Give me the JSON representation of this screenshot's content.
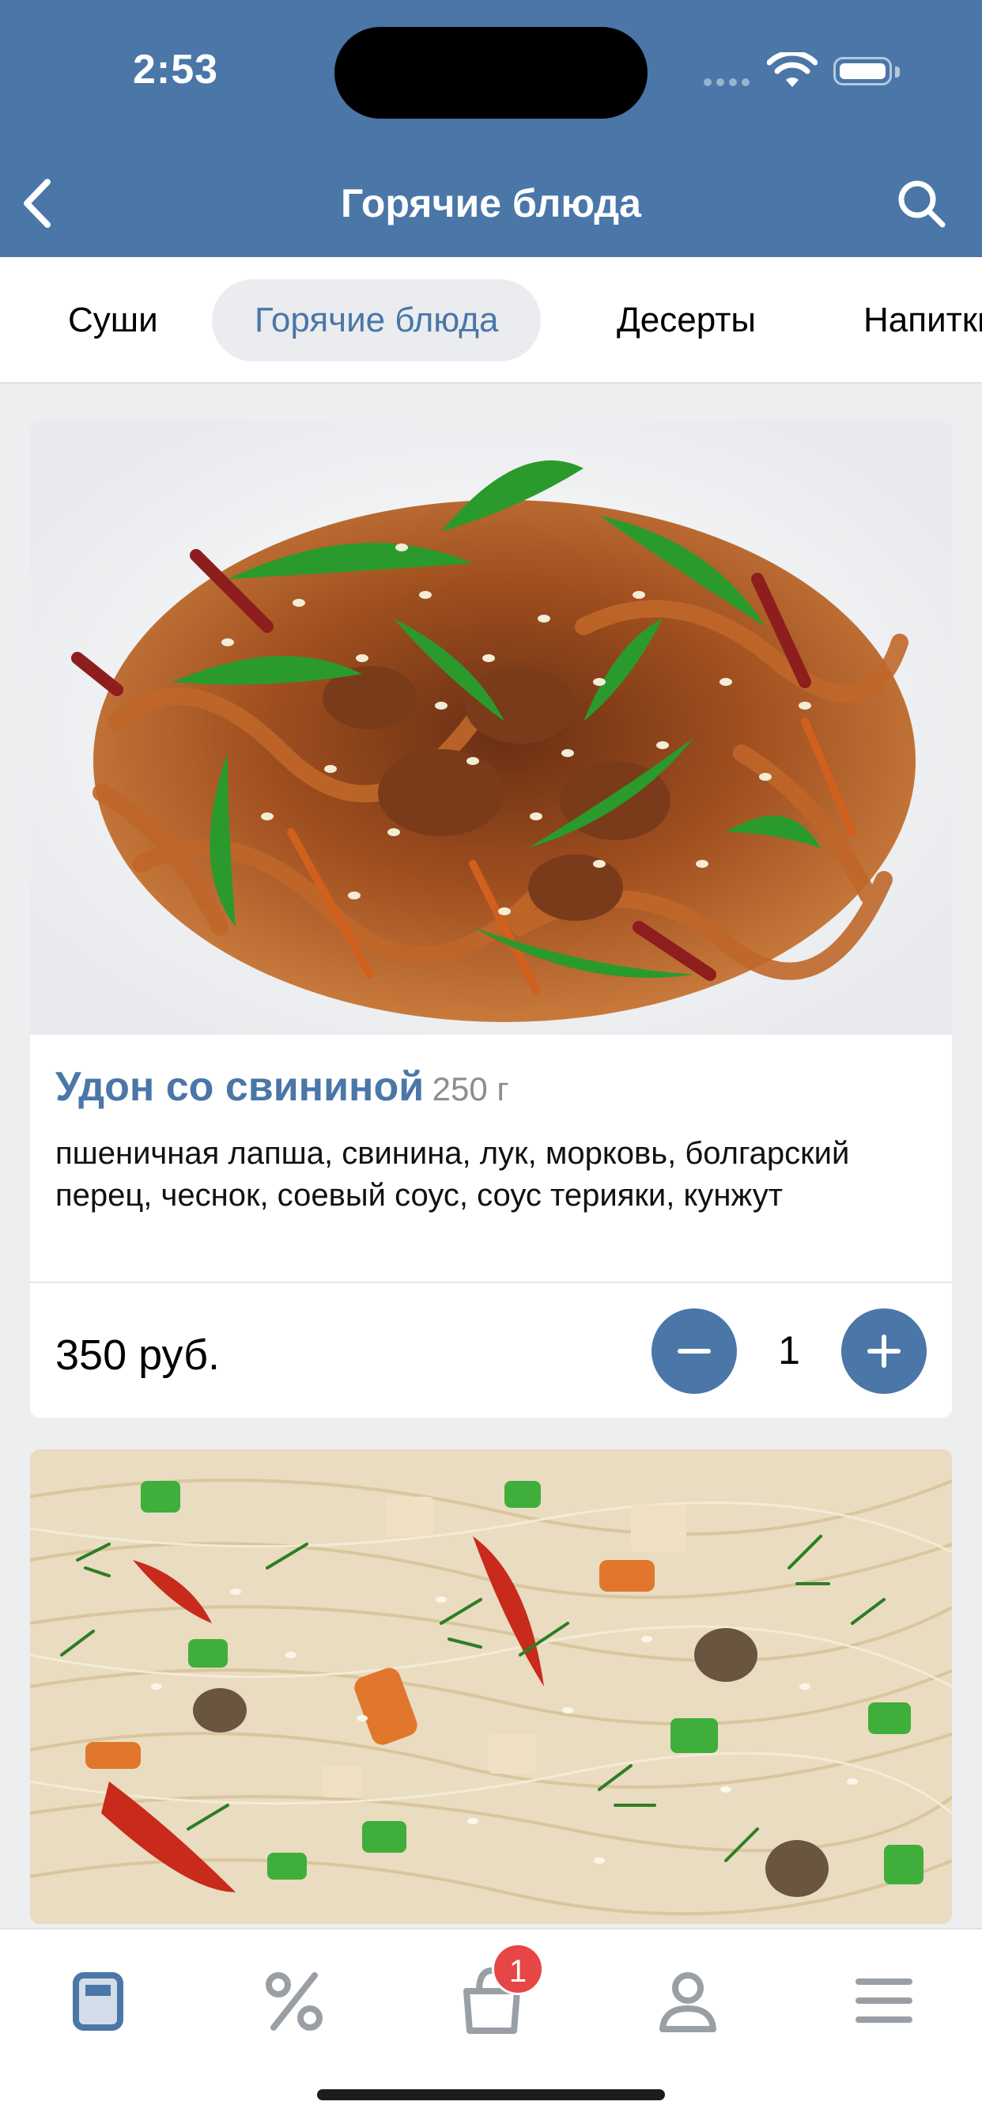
{
  "status_bar": {
    "time": "2:53"
  },
  "header": {
    "title": "Горячие блюда"
  },
  "categories": [
    {
      "label": "Суши",
      "active": false
    },
    {
      "label": "Горячие блюда",
      "active": true
    },
    {
      "label": "Десерты",
      "active": false
    },
    {
      "label": "Напитки",
      "active": false
    }
  ],
  "products": [
    {
      "name": "Удон со свининой",
      "weight": "250 г",
      "description": "пшеничная лапша, свинина, лук, морковь, болгарский перец, чеснок, соевый соус, соус терияки, кунжут",
      "price": "350 руб.",
      "quantity": "1",
      "photo_icon": "udon-noodles-photo"
    },
    {
      "photo_icon": "glass-noodles-photo"
    }
  ],
  "tabbar": {
    "items": [
      "menu-icon",
      "percent-icon",
      "cart-icon",
      "profile-icon",
      "hamburger-icon"
    ],
    "cart_badge": "1"
  },
  "colors": {
    "accent": "#4a76a8",
    "background": "#edeef0",
    "badge": "#e64646"
  }
}
